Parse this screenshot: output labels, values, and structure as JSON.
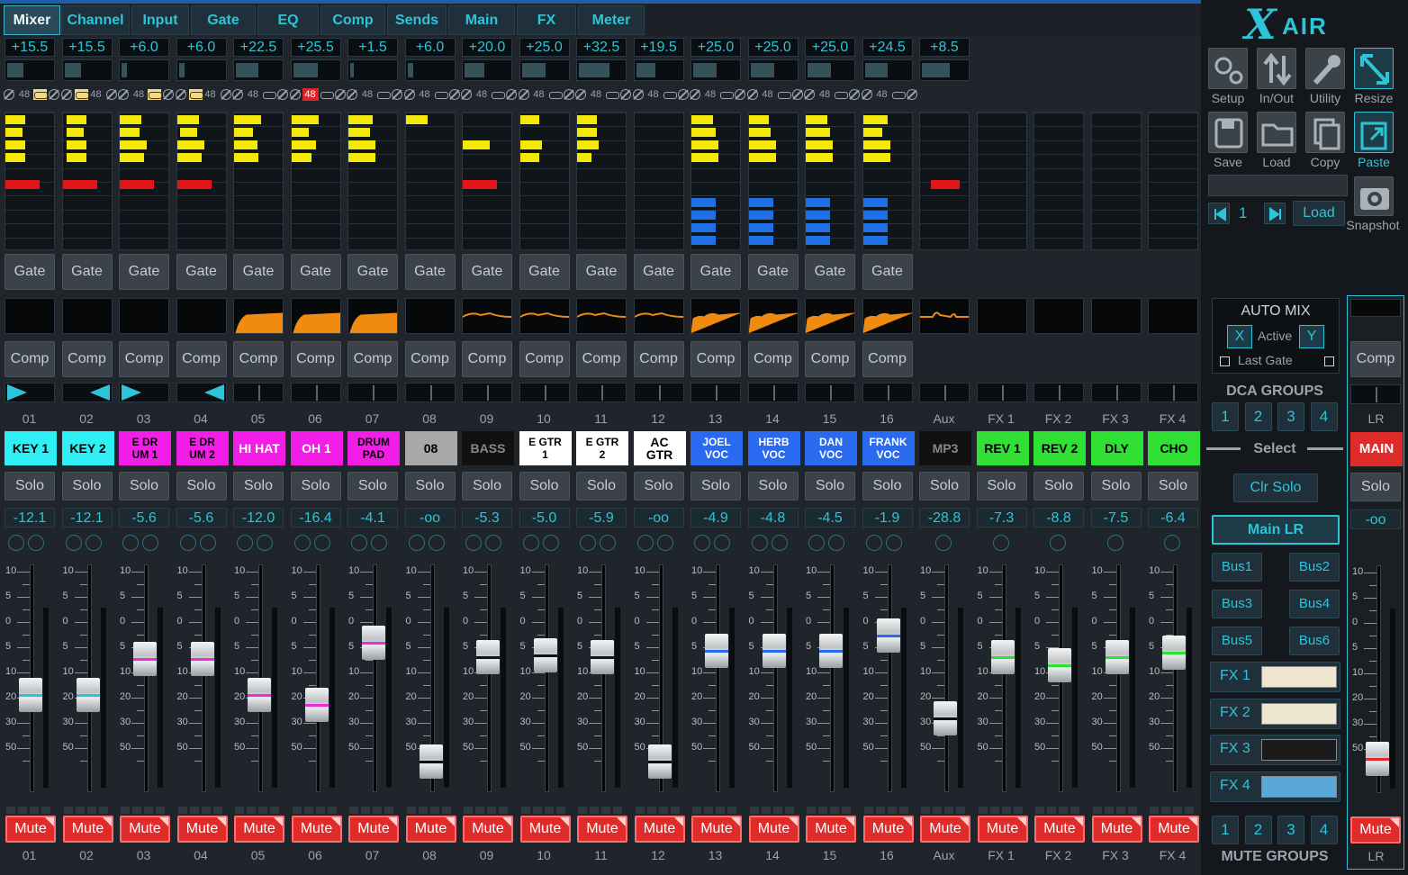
{
  "tabs": [
    "Mixer",
    "Channel",
    "Input",
    "Gate",
    "EQ",
    "Comp",
    "Sends",
    "Main",
    "FX",
    "Meter"
  ],
  "active_tab": "Mixer",
  "brand": {
    "logo_x": "X",
    "logo_air": "AIR"
  },
  "channels": [
    {
      "num": "01",
      "gain": "+15.5",
      "trim": 0.35,
      "ph": "48",
      "p48on": false,
      "lnk": "right",
      "meter": [
        {
          "c": "y",
          "l": 0,
          "w": 0.4
        },
        {
          "c": "y",
          "l": 0,
          "w": 0.35
        },
        {
          "c": "y",
          "l": 0,
          "w": 0.4
        },
        {
          "c": "y",
          "l": 0,
          "w": 0.4
        },
        {
          "c": "n"
        },
        {
          "c": "r",
          "l": 0,
          "w": 0.7
        }
      ],
      "bmeter": [],
      "gate": "Gate",
      "comp": "Comp",
      "graph": "none",
      "pan": "r",
      "name": "KEY 1",
      "sc": "#2ef0f4",
      "tc": "#000",
      "level": "-12.1",
      "knobs": 2,
      "fader": 0.58,
      "fc": "#2ec4d8",
      "mute": "Mute"
    },
    {
      "num": "02",
      "gain": "+15.5",
      "trim": 0.35,
      "ph": "48",
      "p48on": false,
      "lnk": "left",
      "meter": [
        {
          "c": "y",
          "l": 0.08,
          "w": 0.4
        },
        {
          "c": "y",
          "l": 0.08,
          "w": 0.35
        },
        {
          "c": "y",
          "l": 0.08,
          "w": 0.4
        },
        {
          "c": "y",
          "l": 0.08,
          "w": 0.4
        },
        {
          "c": "n"
        },
        {
          "c": "r",
          "l": 0,
          "w": 0.7
        }
      ],
      "bmeter": [],
      "gate": "Gate",
      "comp": "Comp",
      "graph": "none",
      "pan": "l",
      "name": "KEY 2",
      "sc": "#2ef0f4",
      "tc": "#000",
      "level": "-12.1",
      "knobs": 2,
      "fader": 0.58,
      "fc": "#2ec4d8",
      "mute": "Mute"
    },
    {
      "num": "03",
      "gain": "+6.0",
      "trim": 0.12,
      "ph": "48",
      "p48on": false,
      "lnk": "right",
      "meter": [
        {
          "c": "y",
          "l": 0,
          "w": 0.45
        },
        {
          "c": "y",
          "l": 0,
          "w": 0.4
        },
        {
          "c": "y",
          "l": 0,
          "w": 0.55
        },
        {
          "c": "y",
          "l": 0,
          "w": 0.5
        },
        {
          "c": "n"
        },
        {
          "c": "r",
          "l": 0,
          "w": 0.7
        }
      ],
      "bmeter": [],
      "gate": "Gate",
      "comp": "Comp",
      "graph": "none",
      "pan": "r",
      "name": "E DR\nUM 1",
      "sc": "#f21ee8",
      "tc": "#000",
      "level": "-5.6",
      "knobs": 2,
      "fader": 0.4,
      "fc": "#f02ad8",
      "mute": "Mute"
    },
    {
      "num": "04",
      "gain": "+6.0",
      "trim": 0.12,
      "ph": "48",
      "p48on": false,
      "lnk": "left",
      "meter": [
        {
          "c": "y",
          "l": 0,
          "w": 0.45
        },
        {
          "c": "y",
          "l": 0.05,
          "w": 0.35
        },
        {
          "c": "y",
          "l": 0,
          "w": 0.55
        },
        {
          "c": "y",
          "l": 0,
          "w": 0.5
        },
        {
          "c": "n"
        },
        {
          "c": "r",
          "l": 0,
          "w": 0.7
        }
      ],
      "bmeter": [],
      "gate": "Gate",
      "comp": "Comp",
      "graph": "none",
      "pan": "l",
      "name": "E DR\nUM 2",
      "sc": "#f21ee8",
      "tc": "#000",
      "level": "-5.6",
      "knobs": 2,
      "fader": 0.4,
      "fc": "#f02ad8",
      "mute": "Mute"
    },
    {
      "num": "05",
      "gain": "+22.5",
      "trim": 0.48,
      "ph": "48",
      "p48on": false,
      "lnk": "plain",
      "meter": [
        {
          "c": "y",
          "l": 0,
          "w": 0.55
        },
        {
          "c": "y",
          "l": 0,
          "w": 0.38
        },
        {
          "c": "y",
          "l": 0,
          "w": 0.48
        },
        {
          "c": "y",
          "l": 0,
          "w": 0.5
        },
        {
          "c": "n"
        },
        {
          "c": "n"
        }
      ],
      "bmeter": [],
      "gate": "Gate",
      "comp": "Comp",
      "graph": "rise",
      "pan": "c",
      "name": "HI HAT",
      "sc": "#f21ee8",
      "tc": "#fff",
      "level": "-12.0",
      "knobs": 2,
      "fader": 0.58,
      "fc": "#f02ad8",
      "mute": "Mute"
    },
    {
      "num": "06",
      "gain": "+25.5",
      "trim": 0.52,
      "ph": "48",
      "p48on": true,
      "lnk": "plain",
      "meter": [
        {
          "c": "y",
          "l": 0,
          "w": 0.55
        },
        {
          "c": "y",
          "l": 0,
          "w": 0.35
        },
        {
          "c": "y",
          "l": 0,
          "w": 0.5
        },
        {
          "c": "y",
          "l": 0,
          "w": 0.4
        },
        {
          "c": "n"
        },
        {
          "c": "n"
        }
      ],
      "bmeter": [],
      "gate": "Gate",
      "comp": "Comp",
      "graph": "rise",
      "pan": "c",
      "name": "OH 1",
      "sc": "#f21ee8",
      "tc": "#fff",
      "level": "-16.4",
      "knobs": 2,
      "fader": 0.63,
      "fc": "#f02ad8",
      "mute": "Mute"
    },
    {
      "num": "07",
      "gain": "+1.5",
      "trim": 0.08,
      "ph": "48",
      "p48on": false,
      "lnk": "plain",
      "meter": [
        {
          "c": "y",
          "l": 0,
          "w": 0.5
        },
        {
          "c": "y",
          "l": 0,
          "w": 0.45
        },
        {
          "c": "y",
          "l": 0,
          "w": 0.55
        },
        {
          "c": "y",
          "l": 0,
          "w": 0.55
        },
        {
          "c": "n"
        },
        {
          "c": "n"
        }
      ],
      "bmeter": [],
      "gate": "Gate",
      "comp": "Comp",
      "graph": "rise",
      "pan": "c",
      "name": "DRUM\nPAD",
      "sc": "#f21ee8",
      "tc": "#000",
      "level": "-4.1",
      "knobs": 2,
      "fader": 0.32,
      "fc": "#f02ad8",
      "mute": "Mute"
    },
    {
      "num": "08",
      "gain": "+6.0",
      "trim": 0.12,
      "ph": "48",
      "p48on": false,
      "lnk": "plain",
      "meter": [
        {
          "c": "y",
          "l": 0,
          "w": 0.45
        },
        {
          "c": "n"
        },
        {
          "c": "n"
        },
        {
          "c": "n"
        },
        {
          "c": "n"
        },
        {
          "c": "n"
        }
      ],
      "bmeter": [],
      "gate": "Gate",
      "comp": "Comp",
      "graph": "none",
      "pan": "c",
      "name": "08",
      "sc": "#a8a8a8",
      "tc": "#000",
      "level": "-oo",
      "knobs": 2,
      "fader": 0.92,
      "fc": "#111",
      "mute": "Mute"
    },
    {
      "num": "09",
      "gain": "+20.0",
      "trim": 0.42,
      "ph": "48",
      "p48on": false,
      "lnk": "plain",
      "meter": [
        {
          "c": "n"
        },
        {
          "c": "n"
        },
        {
          "c": "y",
          "l": 0,
          "w": 0.55
        },
        {
          "c": "n"
        },
        {
          "c": "n"
        },
        {
          "c": "r",
          "l": 0,
          "w": 0.7
        }
      ],
      "bmeter": [],
      "gate": "Gate",
      "comp": "Comp",
      "graph": "flat",
      "pan": "c",
      "name": "BASS",
      "sc": "#111111",
      "tc": "#888",
      "level": "-5.3",
      "knobs": 2,
      "fader": 0.39,
      "fc": "#111",
      "mute": "Mute"
    },
    {
      "num": "10",
      "gain": "+25.0",
      "trim": 0.5,
      "ph": "48",
      "p48on": false,
      "lnk": "plain",
      "meter": [
        {
          "c": "y",
          "l": 0,
          "w": 0.38
        },
        {
          "c": "n"
        },
        {
          "c": "y",
          "l": 0,
          "w": 0.45
        },
        {
          "c": "y",
          "l": 0,
          "w": 0.38
        },
        {
          "c": "n"
        },
        {
          "c": "n"
        }
      ],
      "bmeter": [],
      "gate": "Gate",
      "comp": "Comp",
      "graph": "flat",
      "pan": "c",
      "name": "E GTR\n1",
      "sc": "#ffffff",
      "tc": "#000",
      "level": "-5.0",
      "knobs": 2,
      "fader": 0.38,
      "fc": "#111",
      "mute": "Mute"
    },
    {
      "num": "11",
      "gain": "+32.5",
      "trim": 0.65,
      "ph": "48",
      "p48on": false,
      "lnk": "plain",
      "meter": [
        {
          "c": "y",
          "l": 0,
          "w": 0.4
        },
        {
          "c": "y",
          "l": 0,
          "w": 0.4
        },
        {
          "c": "y",
          "l": 0,
          "w": 0.45
        },
        {
          "c": "y",
          "l": 0,
          "w": 0.3
        },
        {
          "c": "n"
        },
        {
          "c": "n"
        }
      ],
      "bmeter": [],
      "gate": "Gate",
      "comp": "Comp",
      "graph": "flat",
      "pan": "c",
      "name": "E GTR\n2",
      "sc": "#ffffff",
      "tc": "#000",
      "level": "-5.9",
      "knobs": 2,
      "fader": 0.39,
      "fc": "#111",
      "mute": "Mute"
    },
    {
      "num": "12",
      "gain": "+19.5",
      "trim": 0.4,
      "ph": "48",
      "p48on": false,
      "lnk": "plain",
      "meter": [
        {
          "c": "n"
        },
        {
          "c": "n"
        },
        {
          "c": "n"
        },
        {
          "c": "n"
        },
        {
          "c": "n"
        },
        {
          "c": "n"
        }
      ],
      "bmeter": [],
      "gate": "Gate",
      "comp": "Comp",
      "graph": "flat",
      "pan": "c",
      "name": "AC GTR",
      "sc": "#ffffff",
      "tc": "#000",
      "level": "-oo",
      "knobs": 2,
      "fader": 0.92,
      "fc": "#111",
      "mute": "Mute"
    },
    {
      "num": "13",
      "gain": "+25.0",
      "trim": 0.5,
      "ph": "48",
      "p48on": false,
      "lnk": "plain",
      "meter": [
        {
          "c": "y",
          "l": 0,
          "w": 0.45
        },
        {
          "c": "y",
          "l": 0,
          "w": 0.5
        },
        {
          "c": "y",
          "l": 0,
          "w": 0.55
        },
        {
          "c": "y",
          "l": 0,
          "w": 0.55
        },
        {
          "c": "n"
        },
        {
          "c": "n"
        }
      ],
      "bmeter": [
        0.5,
        0.5,
        0.5,
        0.5
      ],
      "gate": "Gate",
      "comp": "Comp",
      "graph": "flatdip",
      "pan": "c",
      "name": "JOEL\nVOC",
      "sc": "#2a6af0",
      "tc": "#fff",
      "level": "-4.9",
      "knobs": 2,
      "fader": 0.36,
      "fc": "#2a6af0",
      "mute": "Mute"
    },
    {
      "num": "14",
      "gain": "+25.0",
      "trim": 0.5,
      "ph": "48",
      "p48on": false,
      "lnk": "plain",
      "meter": [
        {
          "c": "y",
          "l": 0,
          "w": 0.4
        },
        {
          "c": "y",
          "l": 0,
          "w": 0.45
        },
        {
          "c": "y",
          "l": 0,
          "w": 0.55
        },
        {
          "c": "y",
          "l": 0,
          "w": 0.55
        },
        {
          "c": "n"
        },
        {
          "c": "n"
        }
      ],
      "bmeter": [
        0.5,
        0.5,
        0.5,
        0.5
      ],
      "gate": "Gate",
      "comp": "Comp",
      "graph": "flatdip",
      "pan": "c",
      "name": "HERB\nVOC",
      "sc": "#2a6af0",
      "tc": "#fff",
      "level": "-4.8",
      "knobs": 2,
      "fader": 0.36,
      "fc": "#2a6af0",
      "mute": "Mute"
    },
    {
      "num": "15",
      "gain": "+25.0",
      "trim": 0.5,
      "ph": "48",
      "p48on": false,
      "lnk": "plain",
      "meter": [
        {
          "c": "y",
          "l": 0,
          "w": 0.45
        },
        {
          "c": "y",
          "l": 0,
          "w": 0.5
        },
        {
          "c": "y",
          "l": 0,
          "w": 0.55
        },
        {
          "c": "y",
          "l": 0,
          "w": 0.55
        },
        {
          "c": "n"
        },
        {
          "c": "n"
        }
      ],
      "bmeter": [
        0.5,
        0.5,
        0.5,
        0.5
      ],
      "gate": "Gate",
      "comp": "Comp",
      "graph": "flatdip",
      "pan": "c",
      "name": "DAN\nVOC",
      "sc": "#2a6af0",
      "tc": "#fff",
      "level": "-4.5",
      "knobs": 2,
      "fader": 0.36,
      "fc": "#2a6af0",
      "mute": "Mute"
    },
    {
      "num": "16",
      "gain": "+24.5",
      "trim": 0.49,
      "ph": "48",
      "p48on": false,
      "lnk": "plain",
      "meter": [
        {
          "c": "y",
          "l": 0,
          "w": 0.5
        },
        {
          "c": "y",
          "l": 0,
          "w": 0.38
        },
        {
          "c": "y",
          "l": 0,
          "w": 0.55
        },
        {
          "c": "y",
          "l": 0,
          "w": 0.55
        },
        {
          "c": "n"
        },
        {
          "c": "n"
        }
      ],
      "bmeter": [
        0.5,
        0.5,
        0.5,
        0.5
      ],
      "gate": "Gate",
      "comp": "Comp",
      "graph": "flatdip",
      "pan": "c",
      "name": "FRANK\nVOC",
      "sc": "#2a6af0",
      "tc": "#fff",
      "level": "-1.9",
      "knobs": 2,
      "fader": 0.28,
      "fc": "#2a6af0",
      "mute": "Mute"
    },
    {
      "num": "Aux",
      "gain": "+8.5",
      "trim": 0.6,
      "ph": "",
      "p48on": false,
      "lnk": "none",
      "meter": [
        {
          "c": "n"
        },
        {
          "c": "n"
        },
        {
          "c": "n"
        },
        {
          "c": "n"
        },
        {
          "c": "n"
        },
        {
          "c": "r",
          "l": 0.22,
          "w": 0.6
        }
      ],
      "bmeter": [],
      "gate": "",
      "comp": "",
      "graph": "flatbump",
      "pan": "c",
      "name": "MP3",
      "sc": "#111111",
      "tc": "#888",
      "level": "-28.8",
      "knobs": 1,
      "fader": 0.7,
      "fc": "#111",
      "mute": "Mute"
    },
    {
      "num": "FX 1",
      "gain": "",
      "trim": 0,
      "ph": "",
      "p48on": false,
      "lnk": "none",
      "meter": [],
      "bmeter": [],
      "gate": "",
      "comp": "",
      "graph": "blank",
      "pan": "c",
      "name": "REV 1",
      "sc": "#30e034",
      "tc": "#000",
      "level": "-7.3",
      "knobs": 1,
      "fader": 0.39,
      "fc": "#30e034",
      "mute": "Mute"
    },
    {
      "num": "FX 2",
      "gain": "",
      "trim": 0,
      "ph": "",
      "p48on": false,
      "lnk": "none",
      "meter": [],
      "bmeter": [],
      "gate": "",
      "comp": "",
      "graph": "blank",
      "pan": "c",
      "name": "REV 2",
      "sc": "#30e034",
      "tc": "#000",
      "level": "-8.8",
      "knobs": 1,
      "fader": 0.43,
      "fc": "#30e034",
      "mute": "Mute"
    },
    {
      "num": "FX 3",
      "gain": "",
      "trim": 0,
      "ph": "",
      "p48on": false,
      "lnk": "none",
      "meter": [],
      "bmeter": [],
      "gate": "",
      "comp": "",
      "graph": "blank",
      "pan": "c",
      "name": "DLY",
      "sc": "#30e034",
      "tc": "#000",
      "level": "-7.5",
      "knobs": 1,
      "fader": 0.39,
      "fc": "#30e034",
      "mute": "Mute"
    },
    {
      "num": "FX 4",
      "gain": "",
      "trim": 0,
      "ph": "",
      "p48on": false,
      "lnk": "none",
      "meter": [],
      "bmeter": [],
      "gate": "",
      "comp": "",
      "graph": "blank",
      "pan": "c",
      "name": "CHO",
      "sc": "#30e034",
      "tc": "#000",
      "level": "-6.4",
      "knobs": 1,
      "fader": 0.37,
      "fc": "#30e034",
      "mute": "Mute"
    }
  ],
  "solo_label": "Solo",
  "scale": [
    "10",
    "5",
    "0",
    "5",
    "10",
    "20",
    "30",
    "50"
  ],
  "right": {
    "setup": "Setup",
    "inout": "In/Out",
    "utility": "Utility",
    "resize": "Resize",
    "save": "Save",
    "load": "Load",
    "copy": "Copy",
    "paste": "Paste",
    "snapshot_num": "1",
    "snapshot_load": "Load",
    "snapshot": "Snapshot",
    "automix": {
      "title": "AUTO MIX",
      "x": "X",
      "active": "Active",
      "y": "Y",
      "lastgate": "Last Gate"
    },
    "dca_title": "DCA GROUPS",
    "dca": [
      "1",
      "2",
      "3",
      "4"
    ],
    "select": "Select",
    "clr_solo": "Clr Solo",
    "main_lr": "Main LR",
    "buses": [
      "Bus1",
      "Bus2",
      "Bus3",
      "Bus4",
      "Bus5",
      "Bus6"
    ],
    "fx": [
      "FX 1",
      "FX 2",
      "FX 3",
      "FX 4"
    ],
    "mute_groups": [
      "1",
      "2",
      "3",
      "4"
    ],
    "mute_groups_title": "MUTE GROUPS"
  },
  "lr": {
    "comp": "Comp",
    "label": "LR",
    "name": "MAIN",
    "solo": "Solo",
    "level": "-oo",
    "fader": 0.9,
    "mute": "Mute",
    "num": "LR"
  }
}
